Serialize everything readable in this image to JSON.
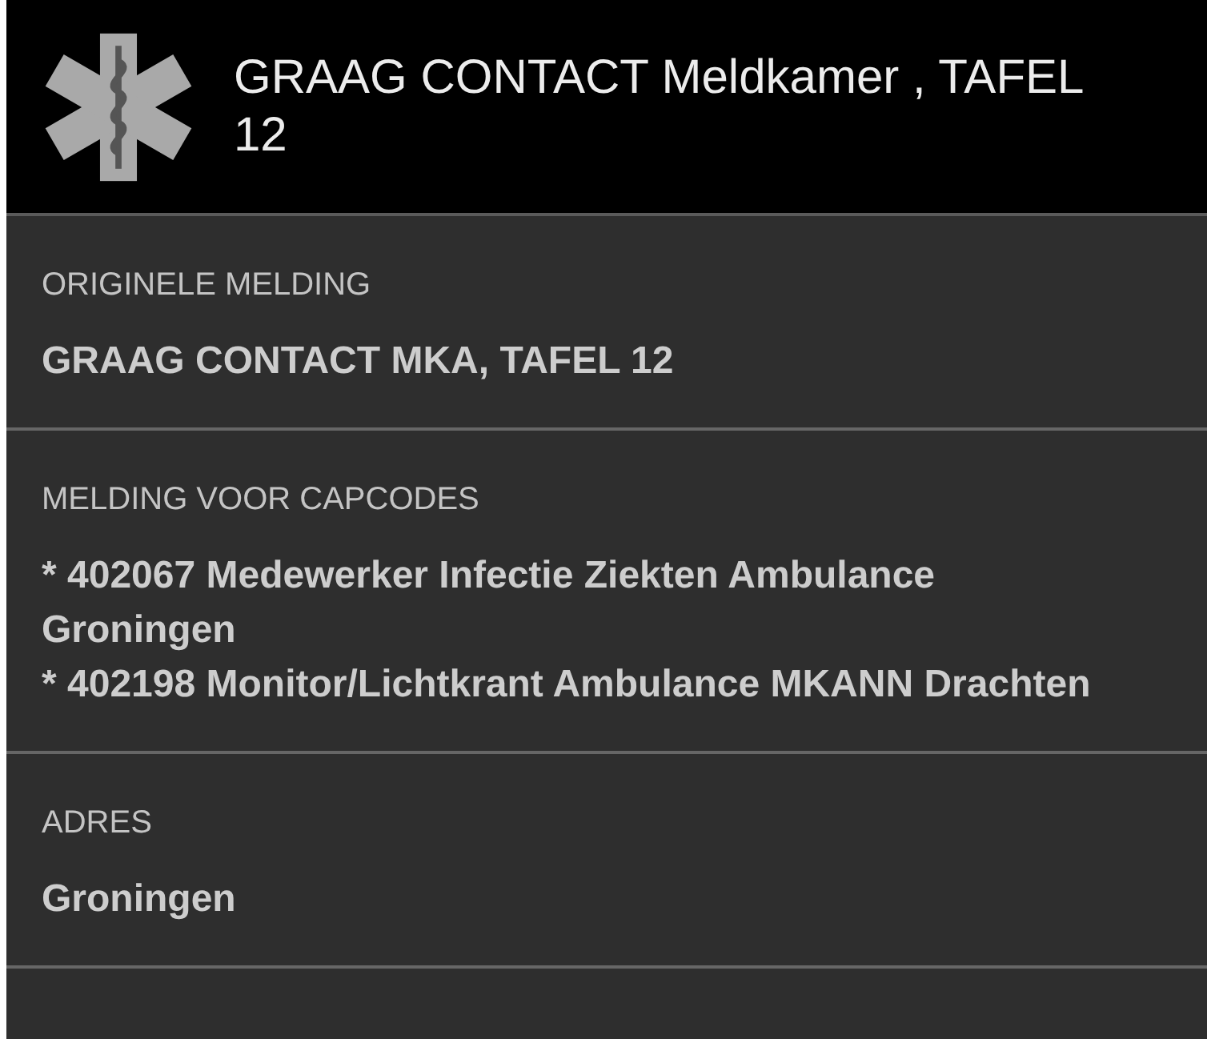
{
  "header": {
    "title": "GRAAG CONTACT Meldkamer , TAFEL 12"
  },
  "sections": [
    {
      "label": "ORIGINELE MELDING",
      "lines": [
        "GRAAG CONTACT MKA, TAFEL 12"
      ]
    },
    {
      "label": "MELDING VOOR CAPCODES",
      "lines": [
        "* 402067 Medewerker Infectie Ziekten Ambulance Groningen",
        "* 402198 Monitor/Lichtkrant Ambulance MKANN Drachten"
      ]
    },
    {
      "label": "ADRES",
      "lines": [
        "Groningen"
      ]
    }
  ]
}
